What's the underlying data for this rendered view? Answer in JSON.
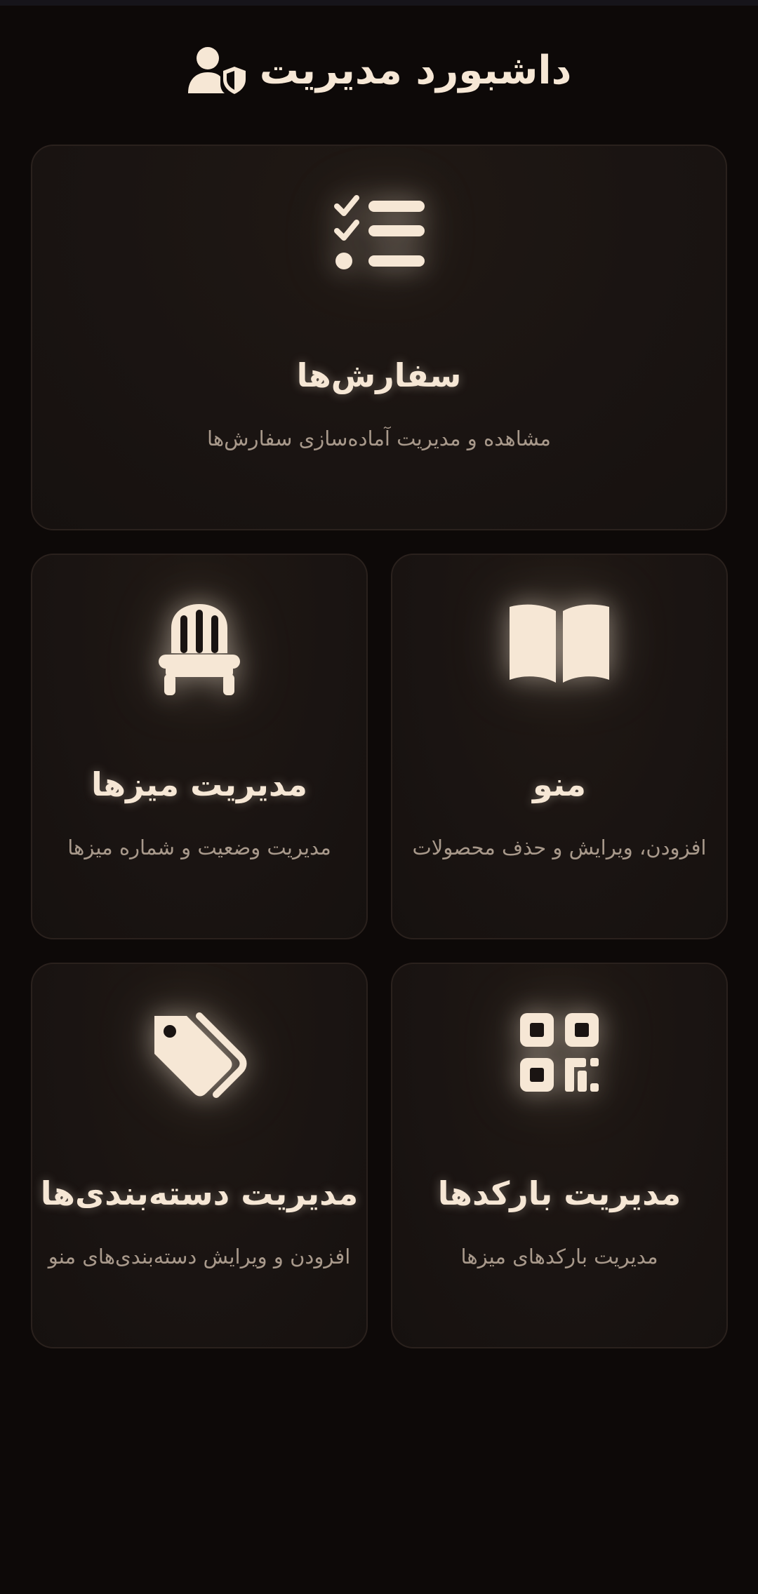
{
  "header": {
    "title": "داشبورد مدیریت",
    "icon": "user-shield-icon"
  },
  "cards": {
    "orders": {
      "title": "سفارش‌ها",
      "description": "مشاهده و مدیریت آماده‌سازی سفارش‌ها",
      "icon": "checklist-icon"
    },
    "menu": {
      "title": "منو",
      "description": "افزودن، ویرایش و حذف محصولات",
      "icon": "book-open-icon"
    },
    "tables": {
      "title": "مدیریت میزها",
      "description": "مدیریت وضعیت و شماره میزها",
      "icon": "chair-icon"
    },
    "qrcodes": {
      "title": "مدیریت بارکدها",
      "description": "مدیریت بارکدهای میزها",
      "icon": "qrcode-icon"
    },
    "categories": {
      "title": "مدیریت دسته‌بندی‌ها",
      "description": "افزودن و ویرایش دسته‌بندی‌های منو",
      "icon": "tags-icon"
    }
  },
  "colors": {
    "background": "#0d0908",
    "card": "#1a1412",
    "card_border": "#2a211d",
    "accent": "#f6e7d5",
    "muted_text": "#a8998b"
  }
}
